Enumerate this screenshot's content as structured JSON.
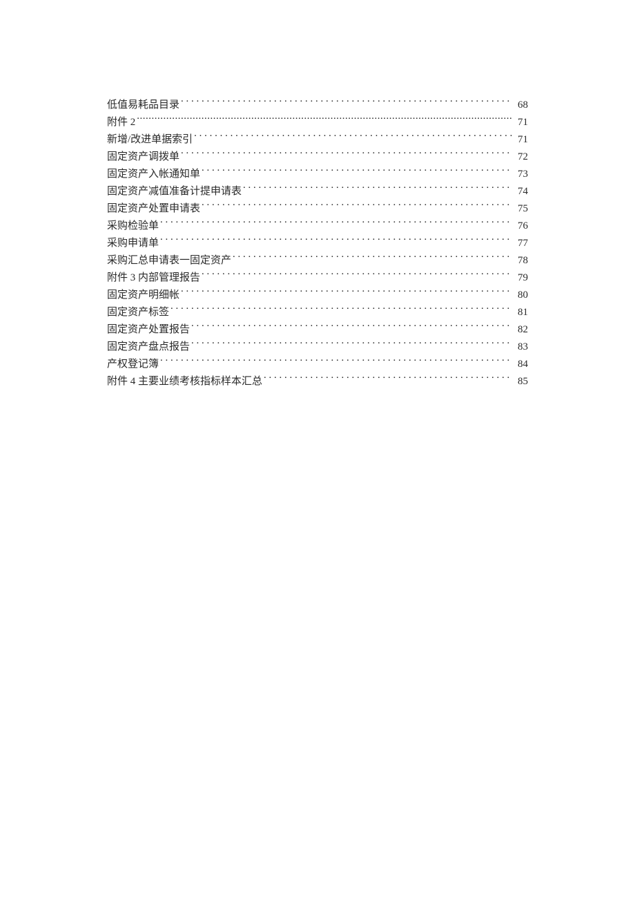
{
  "toc": {
    "entries": [
      {
        "title": "低值易耗品目录",
        "page": "68",
        "dense": false
      },
      {
        "title": "附件 2",
        "page": "71",
        "dense": true
      },
      {
        "title": "新增/改进单据索引",
        "page": "71",
        "dense": false
      },
      {
        "title": "固定资产调拨单",
        "page": "72",
        "dense": false
      },
      {
        "title": "固定资产入帐通知单",
        "page": "73",
        "dense": false
      },
      {
        "title": "固定资产减值准备计提申请表",
        "page": "74",
        "dense": false
      },
      {
        "title": "固定资产处置申请表",
        "page": "75",
        "dense": false
      },
      {
        "title": "采购检验单",
        "page": "76",
        "dense": false
      },
      {
        "title": "采购申请单",
        "page": "77",
        "dense": false
      },
      {
        "title": "采购汇总申请表一固定资产",
        "page": "78",
        "dense": false
      },
      {
        "title": "附件 3 内部管理报告",
        "page": "79",
        "dense": false
      },
      {
        "title": "固定资产明细帐",
        "page": "80",
        "dense": false
      },
      {
        "title": "固定资产标签",
        "page": "81",
        "dense": false
      },
      {
        "title": "固定资产处置报告",
        "page": "82",
        "dense": false
      },
      {
        "title": "固定资产盘点报告",
        "page": "83",
        "dense": false
      },
      {
        "title": "产权登记簿",
        "page": "84",
        "dense": false
      },
      {
        "title": "附件 4 主要业绩考核指标样本汇总",
        "page": "85",
        "dense": false
      }
    ]
  }
}
